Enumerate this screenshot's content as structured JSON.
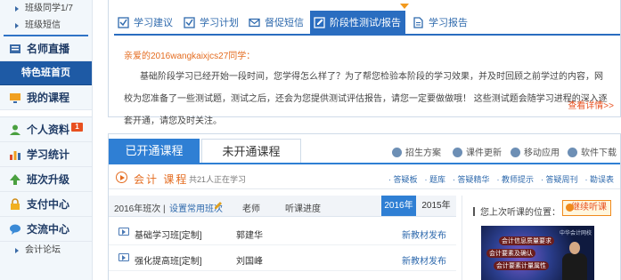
{
  "sidebar": {
    "sub_items_top": [
      "班级同学1/7",
      "班级短信"
    ],
    "live": "名师直播",
    "special": "特色班首页",
    "my_course": "我的课程",
    "profile": "个人资料",
    "profile_badge": "1",
    "stats": "学习统计",
    "upgrade": "班次升级",
    "pay": "支付中心",
    "exchange": "交流中心",
    "forum": "会计论坛"
  },
  "top_tabs": [
    "学习建议",
    "学习计划",
    "督促短信",
    "阶段性测试/报告",
    "学习报告"
  ],
  "notice": {
    "greeting": "亲爱的2016wangkaixjcs27同学：",
    "body": "基础阶段学习已经开始一段时间，您学得怎么样了？为了帮您检验本阶段的学习效果，并及时回顾之前学过的内容，网校为您准备了一些测试题，测试之后，还会为您提供测试评估报告，请您一定要做做哦！ 这些测试题会随学习进程的深入逐套开通，请您及时关注。",
    "more": "查看详情>>"
  },
  "courses": {
    "tab_open": "已开通课程",
    "tab_closed": "未开通课程",
    "top_links": [
      "招生方案",
      "课件更新",
      "移动应用",
      "软件下载"
    ],
    "title": "会计 课程",
    "subtitle": "共21人正在学习",
    "quick_links": [
      "· 答疑板",
      "· 题库",
      "· 答疑精华",
      "· 教师提示",
      "· 答疑周刊",
      "· 勘误表"
    ],
    "table": {
      "class_label": "2016年班次 |",
      "set_common": "设置常用班次",
      "teacher": "老师",
      "progress": "听课进度",
      "years": [
        "2016年",
        "2015年"
      ],
      "rows": [
        {
          "name": "基础学习班[定制]",
          "teacher": "郭建华",
          "status": "新教材发布"
        },
        {
          "name": "强化提高班[定制]",
          "teacher": "刘国峰",
          "status": "新教材发布"
        }
      ]
    },
    "side": {
      "last_position": "您上次听课的位置：",
      "continue": "继续听课",
      "video_lines": [
        "会计信息质量要求",
        "会计要素及确认",
        "会计要素计量属性"
      ],
      "video_logo": "中华会计网校"
    }
  },
  "colors": {
    "primary": "#2f7fd4",
    "accent": "#e46c20",
    "nav_dark": "#1e5aa5"
  }
}
